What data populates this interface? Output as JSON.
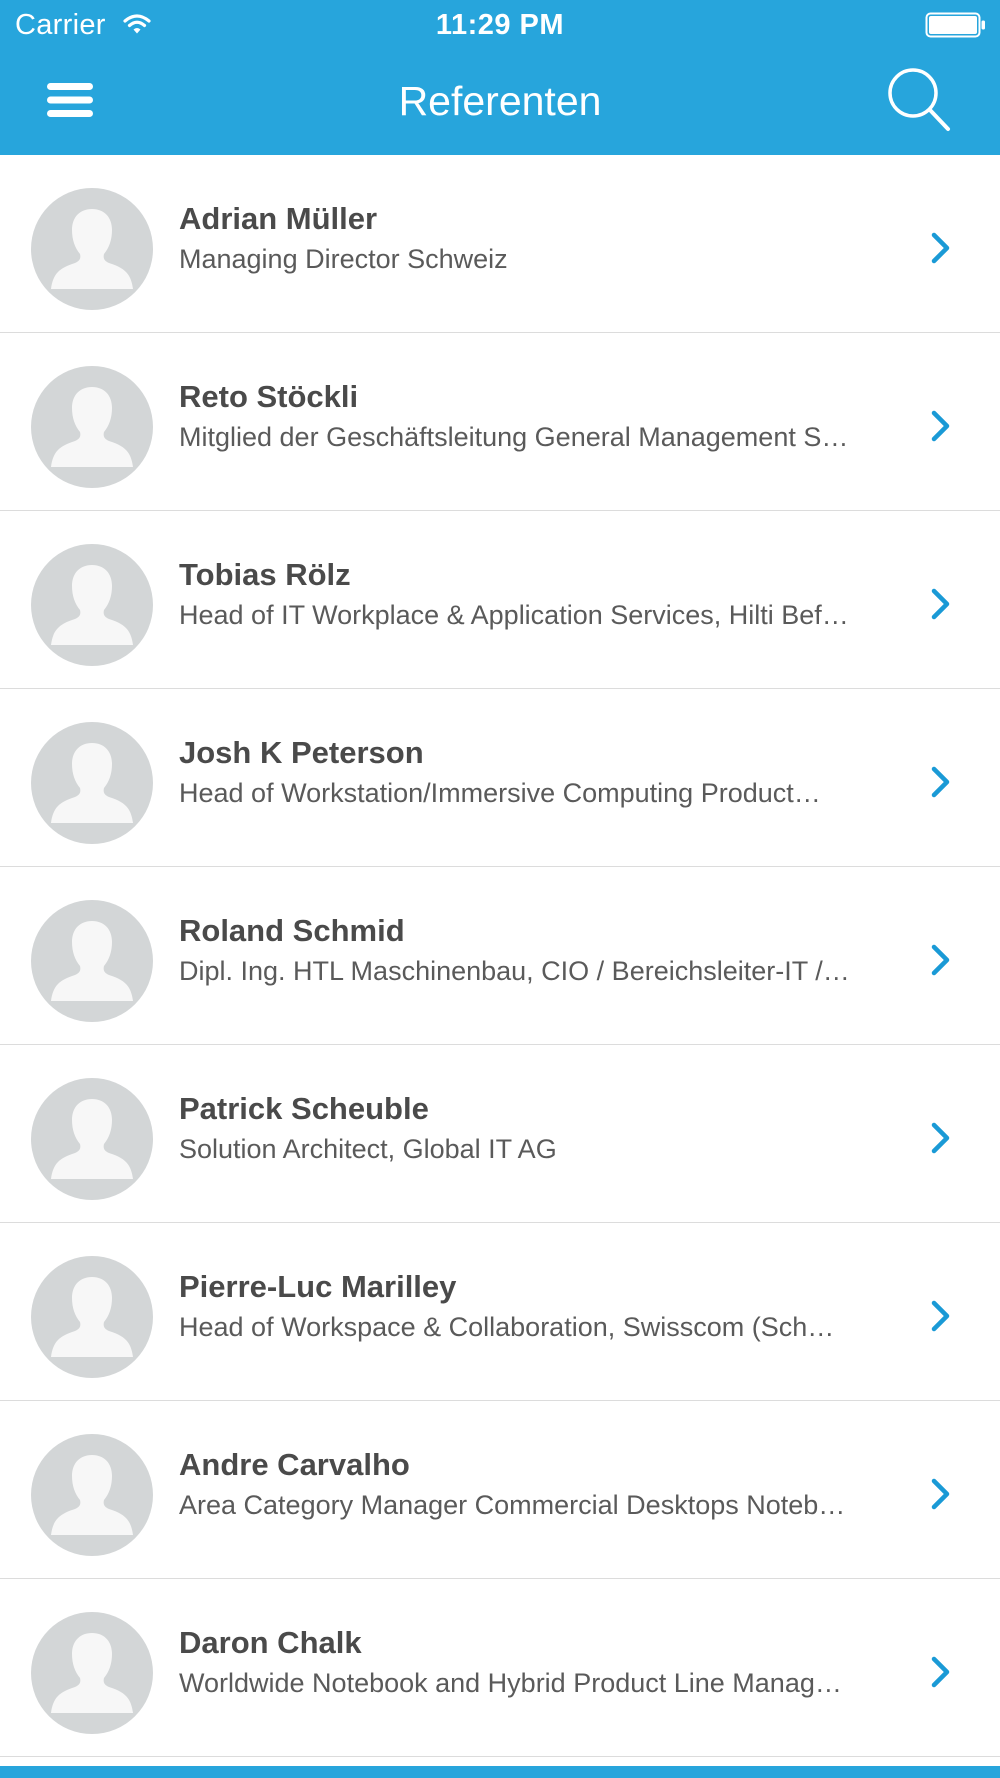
{
  "status_bar": {
    "carrier": "Carrier",
    "time": "11:29 PM"
  },
  "nav": {
    "title": "Referenten",
    "menu_icon": "hamburger-menu-icon",
    "search_icon": "search-icon"
  },
  "colors": {
    "accent": "#27a5dc",
    "avatar_bg": "#d3d6d7",
    "chevron": "#1a9ad6",
    "name_text": "#4a4a4a",
    "subtitle_text": "#5a5a5a"
  },
  "speakers": [
    {
      "name": "Adrian Müller",
      "subtitle": "Managing Director Schweiz"
    },
    {
      "name": "Reto Stöckli",
      "subtitle": "Mitglied der Geschäftsleitung General Management S…"
    },
    {
      "name": "Tobias Rölz",
      "subtitle": "Head of IT Workplace & Application Services, Hilti Bef…"
    },
    {
      "name": "Josh K Peterson",
      "subtitle": "Head of Workstation/Immersive Computing Product…"
    },
    {
      "name": "Roland Schmid",
      "subtitle": "Dipl. Ing. HTL Maschinenbau, CIO / Bereichsleiter-IT /…"
    },
    {
      "name": "Patrick Scheuble",
      "subtitle": "Solution Architect, Global IT AG"
    },
    {
      "name": "Pierre-Luc Marilley",
      "subtitle": "Head of Workspace & Collaboration, Swisscom (Sch…"
    },
    {
      "name": "Andre Carvalho",
      "subtitle": "Area Category Manager Commercial Desktops Noteb…"
    },
    {
      "name": "Daron Chalk",
      "subtitle": "Worldwide Notebook and Hybrid Product Line Manag…"
    }
  ]
}
